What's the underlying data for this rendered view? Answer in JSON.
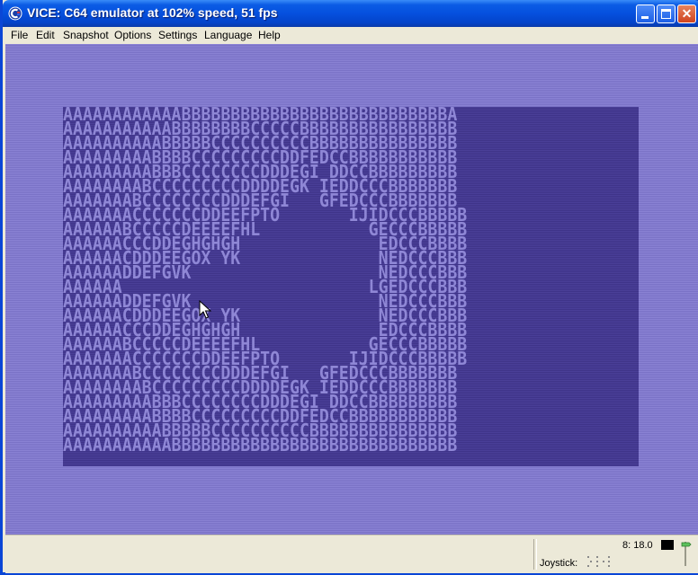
{
  "window": {
    "title": "VICE: C64 emulator at 102% speed, 51 fps"
  },
  "menu": {
    "items": [
      "File",
      "Edit",
      "Snapshot",
      "Options",
      "Settings",
      "Language",
      "Help"
    ]
  },
  "screen": {
    "lines": [
      "AAAAAAAAAAAABBBBBBBBBBBBBBBBBBBBBBBBBBBA",
      "AAAAAAAAAAABBBBBBBBCCCCCBBBBBBBBBBBBBBBB",
      "AAAAAAAAAABBBBBCCCCCCCCCCBBBBBBBBBBBBBBB",
      "AAAAAAAAABBBBCCCCCCCCCDDFEDCCBBBBBBBBBBB",
      "AAAAAAAAABBBCCCCCCCCDDDEGI DDCCBBBBBBBBB",
      "AAAAAAAABCCCCCCCCCDDDDEGK IEDDCCCBBBBBBB",
      "AAAAAAABCCCCCCCCDDDEFGI   GFEDCCCBBBBBBB",
      "AAAAAAACCCCCCCDDEEFPTO       IJIDCCCBBBBB",
      "AAAAAABCCCCCDEEEEFHL           GECCCBBBBB",
      "AAAAAACCCDDEGHGHGH              EDCCCBBBB",
      "AAAAAACDDDEEGOX YK              NEDCCCBBB",
      "AAAAAADDEFGVK                   NEDCCCBBB",
      "AAAAAA                         LGEDCCCBBB",
      "AAAAAADDEFGVK                   NEDCCCBBB",
      "AAAAAACDDDEEGOX YK              NEDCCCBBB",
      "AAAAAACCCDDEGHGHGH              EDCCCBBBB",
      "AAAAAABCCCCCDEEEEFHL           GECCCBBBBB",
      "AAAAAAACCCCCCCDDEEFPTO       IJIDCCCBBBBB",
      "AAAAAAABCCCCCCCCDDDEFGI   GFEDCCCBBBBBBB",
      "AAAAAAAABCCCCCCCCCDDDDEGK IEDDCCCBBBBBBB",
      "AAAAAAAAABBBCCCCCCCCDDDEGI DDCCBBBBBBBBB",
      "AAAAAAAAABBBBCCCCCCCCCDDFEDCCBBBBBBBBBBB",
      "AAAAAAAAAABBBBBCCCCCCCCCCBBBBBBBBBBBBBBB",
      "AAAAAAAAAAABBBBBBBBBBBBBBBBBBBBBBBBBBBBB"
    ]
  },
  "status": {
    "speed": "8: 18.0",
    "joystick_label": "Joystick:"
  },
  "colors": {
    "border": "#7a72c6",
    "background": "#3f3489",
    "text": "#8f87d6"
  }
}
